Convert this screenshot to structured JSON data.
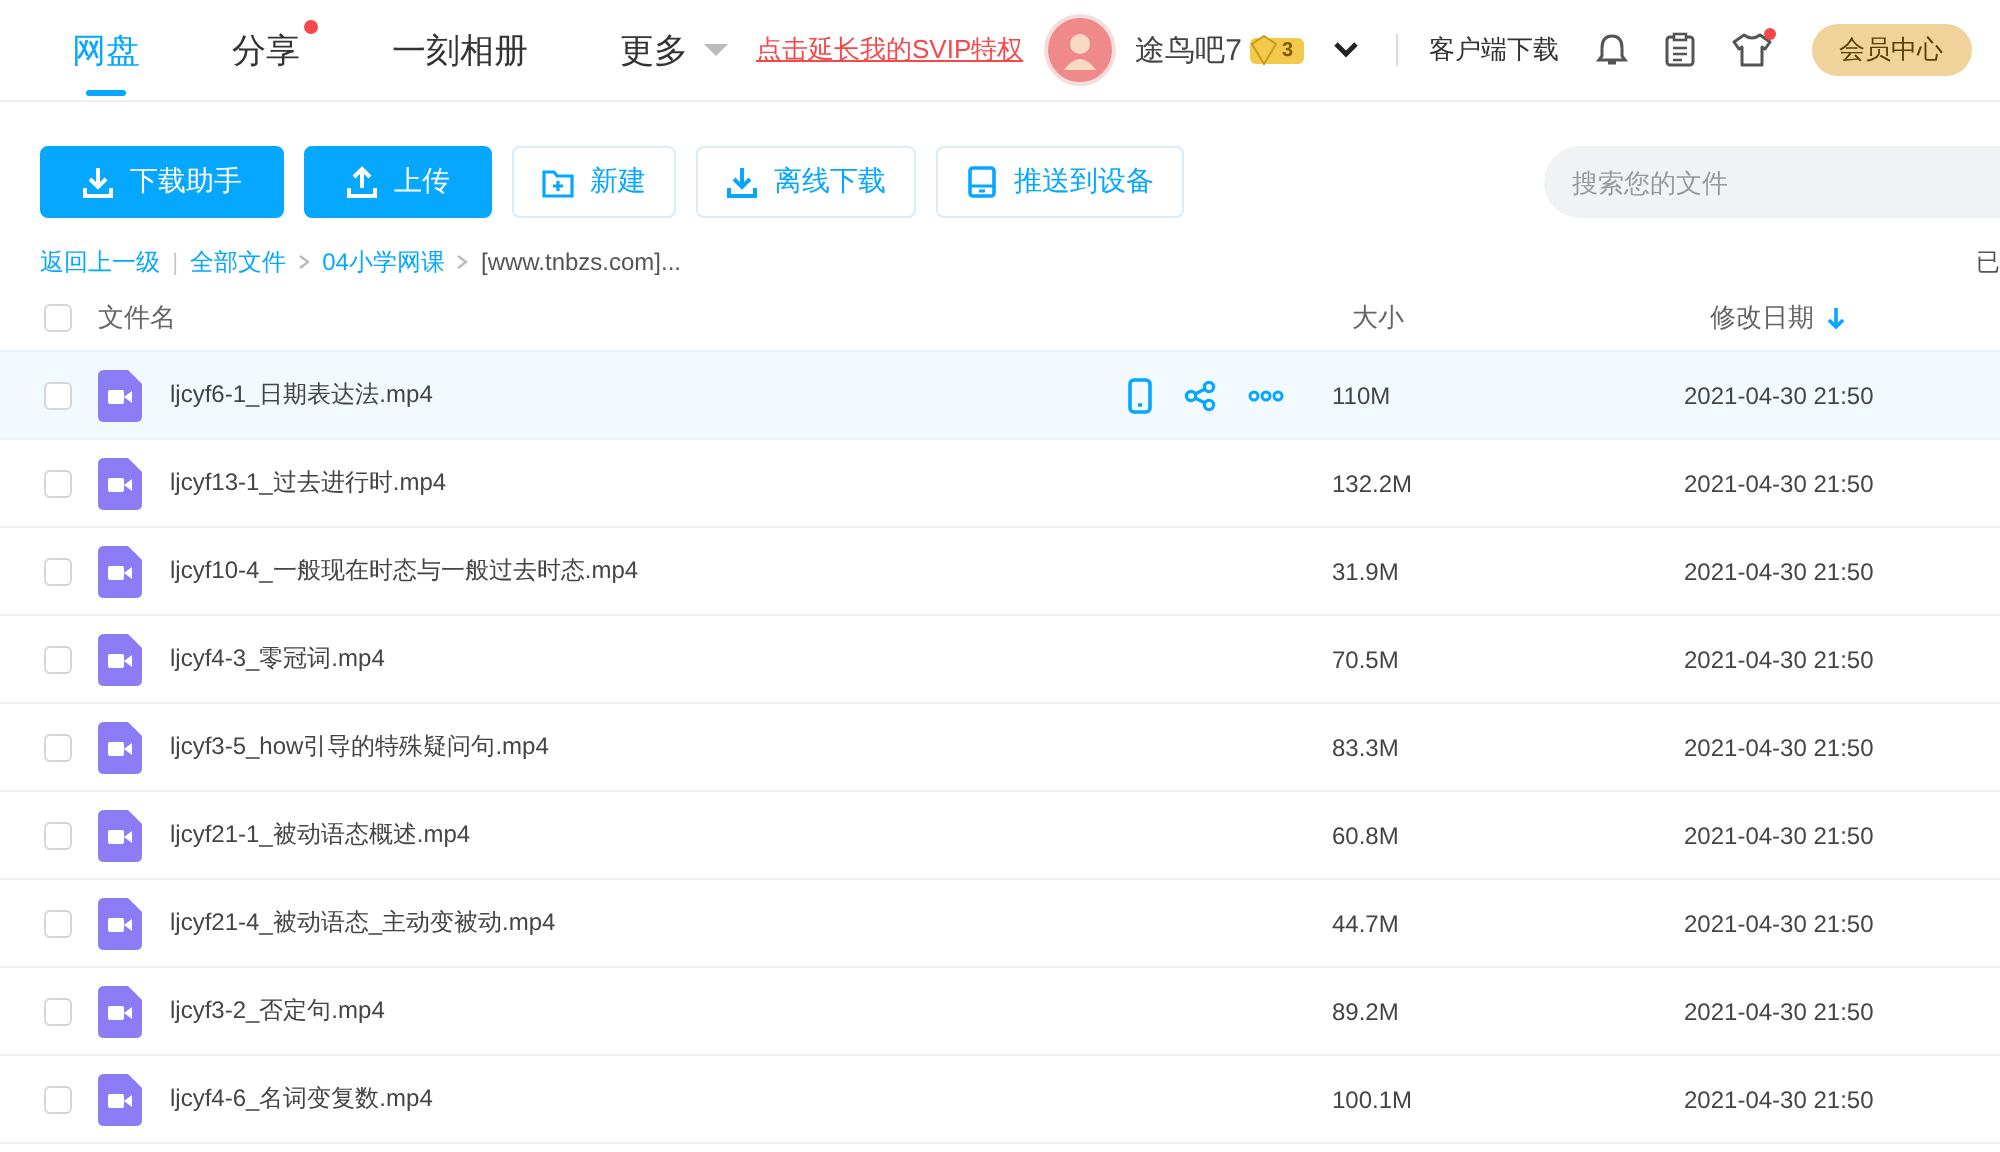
{
  "nav": {
    "tabs": [
      {
        "label": "网盘",
        "selected": true,
        "dot": false,
        "caret": false
      },
      {
        "label": "分享",
        "selected": false,
        "dot": true,
        "caret": false
      },
      {
        "label": "一刻相册",
        "selected": false,
        "dot": false,
        "caret": false
      },
      {
        "label": "更多",
        "selected": false,
        "dot": false,
        "caret": true
      }
    ],
    "promo": "点击延长我的SVIP特权",
    "username": "途鸟吧7",
    "level_badge": "3",
    "client_download": "客户端下载",
    "notice_dot": true,
    "member_button": "会员中心"
  },
  "toolbar": {
    "buttons": [
      {
        "label": "下载助手",
        "kind": "primary"
      },
      {
        "label": "上传",
        "kind": "primary"
      },
      {
        "label": "新建",
        "kind": "outline"
      },
      {
        "label": "离线下载",
        "kind": "outline"
      },
      {
        "label": "推送到设备",
        "kind": "outline"
      }
    ],
    "search": {
      "placeholder": "搜索您的文件"
    }
  },
  "breadcrumb": {
    "back": "返回上一级",
    "divider": "|",
    "items": [
      {
        "label": "全部文件",
        "link": true
      },
      {
        "label": "04小学网课",
        "link": true
      },
      {
        "label": "[www.tnbzs.com]...",
        "link": false
      }
    ],
    "status": "已"
  },
  "table": {
    "select_all_checked": false,
    "columns": [
      "文件名",
      "大小",
      "修改日期"
    ],
    "rows": [
      {
        "name": "ljcyf6-1_日期表达法.mp4",
        "size": "110M",
        "date": "2021-04-30 21:50",
        "checked": false,
        "hovered": true
      },
      {
        "name": "ljcyf13-1_过去进行时.mp4",
        "size": "132.2M",
        "date": "2021-04-30 21:50",
        "checked": false,
        "hovered": false
      },
      {
        "name": "ljcyf10-4_一般现在时态与一般过去时态.mp4",
        "size": "31.9M",
        "date": "2021-04-30 21:50",
        "checked": false,
        "hovered": false
      },
      {
        "name": "ljcyf4-3_零冠词.mp4",
        "size": "70.5M",
        "date": "2021-04-30 21:50",
        "checked": false,
        "hovered": false
      },
      {
        "name": "ljcyf3-5_how引导的特殊疑问句.mp4",
        "size": "83.3M",
        "date": "2021-04-30 21:50",
        "checked": false,
        "hovered": false
      },
      {
        "name": "ljcyf21-1_被动语态概述.mp4",
        "size": "60.8M",
        "date": "2021-04-30 21:50",
        "checked": false,
        "hovered": false
      },
      {
        "name": "ljcyf21-4_被动语态_主动变被动.mp4",
        "size": "44.7M",
        "date": "2021-04-30 21:50",
        "checked": false,
        "hovered": false
      },
      {
        "name": "ljcyf3-2_否定句.mp4",
        "size": "89.2M",
        "date": "2021-04-30 21:50",
        "checked": false,
        "hovered": false
      },
      {
        "name": "ljcyf4-6_名词变复数.mp4",
        "size": "100.1M",
        "date": "2021-04-30 21:50",
        "checked": false,
        "hovered": false
      }
    ]
  }
}
